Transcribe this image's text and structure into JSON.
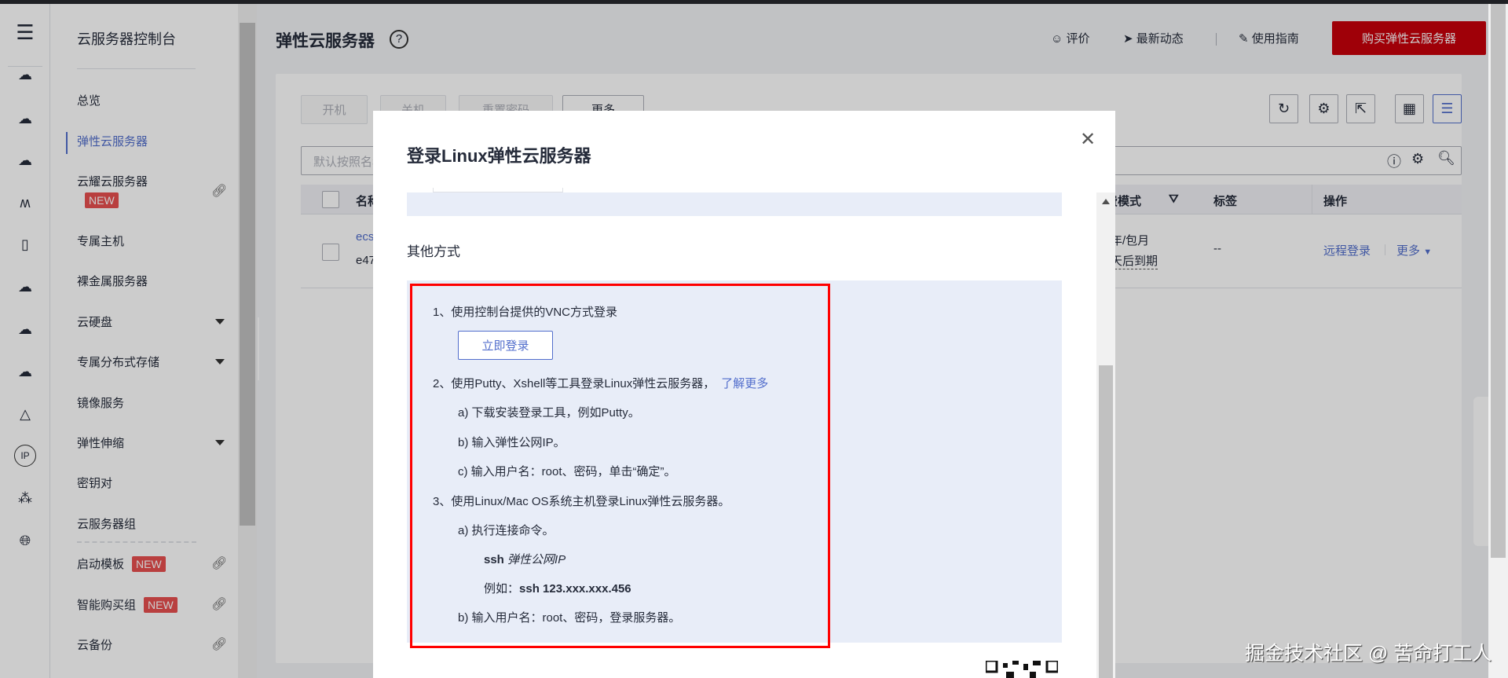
{
  "sidebar": {
    "title": "云服务器控制台",
    "items": [
      {
        "label": "总览"
      },
      {
        "label": "弹性云服务器",
        "active": true
      },
      {
        "label": "云耀云服务器",
        "badge": "NEW"
      },
      {
        "label": "专属主机"
      },
      {
        "label": "裸金属服务器"
      },
      {
        "label": "云硬盘"
      },
      {
        "label": "专属分布式存储"
      },
      {
        "label": "镜像服务"
      },
      {
        "label": "弹性伸缩"
      },
      {
        "label": "密钥对"
      },
      {
        "label": "云服务器组"
      },
      {
        "label": "启动模板",
        "badge": "NEW"
      },
      {
        "label": "智能购买组",
        "badge": "NEW"
      },
      {
        "label": "云备份"
      }
    ]
  },
  "header": {
    "title": "弹性云服务器",
    "rate": "评价",
    "news": "最新动态",
    "guide": "使用指南",
    "buy": "购买弹性云服务器"
  },
  "toolbar": {
    "start": "开机",
    "stop": "关机",
    "reset": "重置密码",
    "more": "更多"
  },
  "search": {
    "placeholder": "默认按照名称搜索"
  },
  "table": {
    "headers": {
      "name": "名称",
      "billing": "计费模式",
      "tags": "标签",
      "actions": "操作"
    },
    "row": {
      "name": "ecs",
      "id": "e47",
      "billing1": "年/包月",
      "billing2": "天后到期",
      "tags": "--",
      "remote": "远程登录",
      "more": "更多"
    }
  },
  "modal": {
    "title": "登录Linux弹性云服务器",
    "other_title": "其他方式",
    "step1": "1、使用控制台提供的VNC方式登录",
    "login_now": "立即登录",
    "step2": "2、使用Putty、Xshell等工具登录Linux弹性云服务器，",
    "learn_more": "了解更多",
    "step2a": "a) 下载安装登录工具，例如Putty。",
    "step2b": "b) 输入弹性公网IP。",
    "step2c": "c) 输入用户名：root、密码，单击“确定”。",
    "step3": "3、使用Linux/Mac OS系统主机登录Linux弹性云服务器。",
    "step3a": "a) 执行连接命令。",
    "ssh_cmd": "ssh",
    "ssh_arg": "弹性公网IP",
    "example_label": "例如：",
    "example_cmd": "ssh 123.xxx.xxx.456",
    "step3b": "b) 输入用户名：root、密码，登录服务器。"
  },
  "watermark": "掘金技术社区 @ 苦命打工人",
  "colors": {
    "brand": "#c7000b",
    "link": "#526ecc",
    "highlight": "#ff0000",
    "panel": "#e8edf8"
  }
}
